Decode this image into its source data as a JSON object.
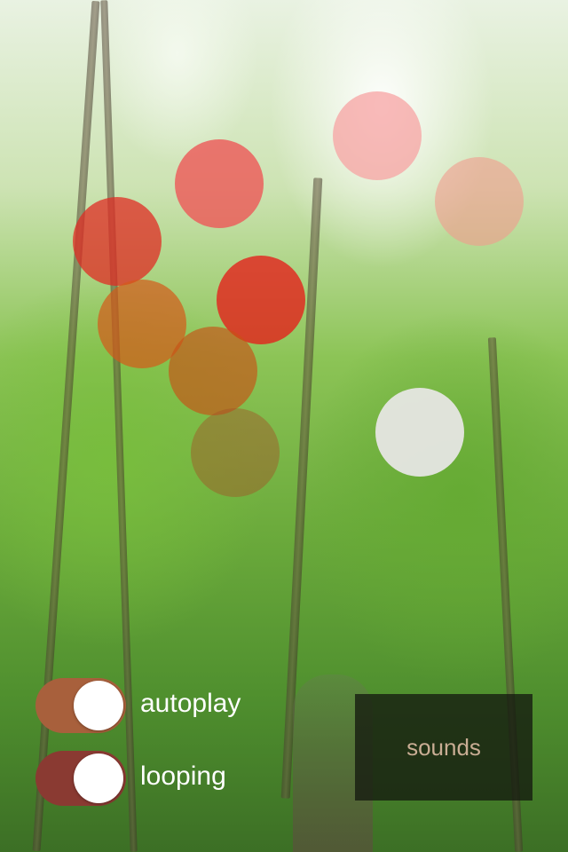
{
  "toggles": [
    {
      "label": "autoplay",
      "on": true,
      "color": "#a8603c"
    },
    {
      "label": "looping",
      "on": true,
      "color": "#8a3a32"
    }
  ],
  "sounds_button": {
    "label": "sounds"
  },
  "balls": [
    {
      "name": "ball-red-top",
      "color": "#ee5757",
      "opacity": 0.8
    },
    {
      "name": "ball-pink-top",
      "color": "#f7a3a3",
      "opacity": 0.75
    },
    {
      "name": "ball-pink-right",
      "color": "#f29b8e",
      "opacity": 0.6
    },
    {
      "name": "ball-red-left",
      "color": "#e02c24",
      "opacity": 0.75
    },
    {
      "name": "ball-red-middle",
      "color": "#e4221b",
      "opacity": 0.8
    },
    {
      "name": "ball-orange-left",
      "color": "#d45a1a",
      "opacity": 0.7
    },
    {
      "name": "ball-orange-middle",
      "color": "#c85216",
      "opacity": 0.65
    },
    {
      "name": "ball-brown",
      "color": "#a45126",
      "opacity": 0.45
    },
    {
      "name": "ball-white",
      "color": "#e6e6e3",
      "opacity": 0.95
    }
  ]
}
